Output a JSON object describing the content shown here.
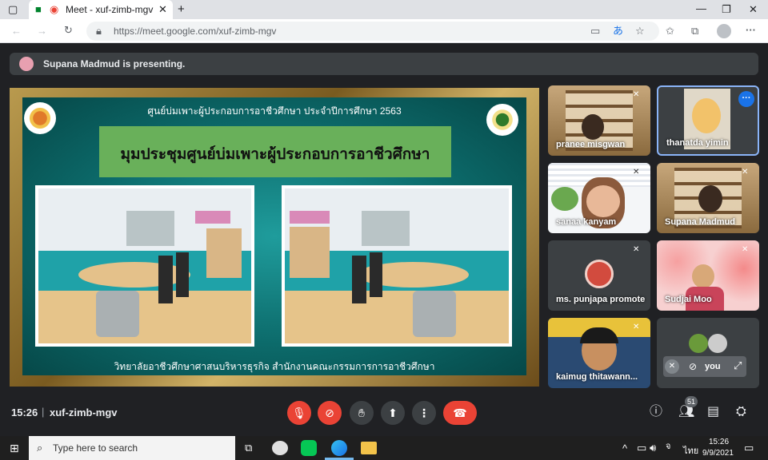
{
  "browser": {
    "tab_title": "Meet - xuf-zimb-mgv",
    "url": "https://meet.google.com/xuf-zimb-mgv"
  },
  "banner": {
    "text": "Supana Madmud is presenting."
  },
  "slide": {
    "header": "ศูนย์บ่มเพาะผู้ประกอบการอาชีวศึกษา  ประจำปีการศึกษา 2563",
    "title": "มุมประชุมศูนย์บ่มเพาะผู้ประกอบการอาชีวศึกษา",
    "footer": "วิทยาลัยอาชีวศึกษาศาสนบริหารธุรกิจ    สำนักงานคณะกรรมการการอาชีวศึกษา"
  },
  "participants": [
    {
      "name": "pranee misgwan"
    },
    {
      "name": "thanatda yimin"
    },
    {
      "name": "sanaa kanyam"
    },
    {
      "name": "Supana Madmud"
    },
    {
      "name": "ms. punjapa promote"
    },
    {
      "name": "Sudjai Moo"
    },
    {
      "name": "kaimug thitawann..."
    },
    {
      "name": "you"
    }
  ],
  "meeting": {
    "time": "15:26",
    "code": "xuf-zimb-mgv",
    "participant_count": "51"
  },
  "taskbar": {
    "search_placeholder": "Type here to search",
    "lang": "ไทย",
    "clock_time": "15:26",
    "clock_date": "9/9/2021"
  },
  "colors": {
    "accent": "#8ab4f8",
    "end_call": "#ea4335",
    "slide_title_bg": "#69b05a"
  }
}
